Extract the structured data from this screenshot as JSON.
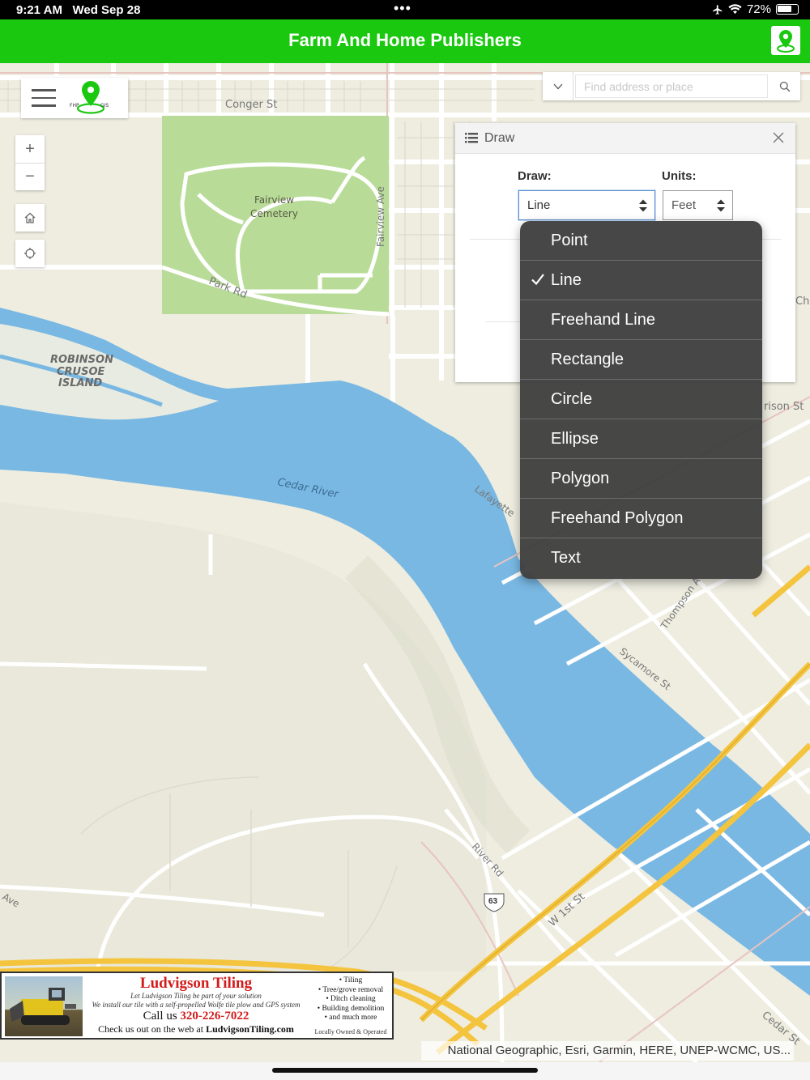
{
  "status_bar": {
    "time": "9:21 AM",
    "date": "Wed Sep 28",
    "battery": "72%",
    "battery_level": 0.72
  },
  "app_bar": {
    "title": "Farm And Home Publishers",
    "logo_icon": "map-pin-icon",
    "accent": "#19c80f"
  },
  "map": {
    "labels": {
      "conger_st": "Conger St",
      "cemetery_1": "Fairview",
      "cemetery_2": "Cemetery",
      "fairview_ave": "Fairview Ave",
      "park_rd": "Park Rd",
      "island_1": "ROBINSON",
      "island_2": "CRUSOE",
      "island_3": "ISLAND",
      "cedar_river": "Cedar River",
      "lafayette": "Lafayette",
      "harrison": "rison St",
      "ch": "Ch",
      "thompson": "Thompson A",
      "sycamore": "Sycamore St",
      "river_rd": "River Rd",
      "w1st": "W 1st St",
      "cedar_st": "Cedar St",
      "hwy": "63",
      "ave": "Ave"
    },
    "water_color": "#79b8e3",
    "park_color": "#b8dc98"
  },
  "menu": {
    "menu_icon": "hamburger-icon",
    "logo_icon": "fhp-gis-logo"
  },
  "controls": {
    "zoom_in": "+",
    "zoom_out": "−",
    "home_icon": "home-icon",
    "locate_icon": "locate-icon"
  },
  "search": {
    "placeholder": "Find address or place",
    "dropdown_icon": "caret-down-icon",
    "search_icon": "search-icon"
  },
  "draw_panel": {
    "title": "Draw",
    "draw_label": "Draw:",
    "draw_value": "Line",
    "units_label": "Units:",
    "units_value": "Feet"
  },
  "draw_options": [
    {
      "label": "Point",
      "selected": false
    },
    {
      "label": "Line",
      "selected": true
    },
    {
      "label": "Freehand Line",
      "selected": false
    },
    {
      "label": "Rectangle",
      "selected": false
    },
    {
      "label": "Circle",
      "selected": false
    },
    {
      "label": "Ellipse",
      "selected": false
    },
    {
      "label": "Polygon",
      "selected": false
    },
    {
      "label": "Freehand Polygon",
      "selected": false
    },
    {
      "label": "Text",
      "selected": false
    }
  ],
  "ad": {
    "brand": "Ludvigson Tiling",
    "tag_1": "Let Ludvigson Tiling be part of your solution",
    "tag_2": "We install our tile with a self-propelled Wolfe tile plow and GPS system",
    "call_prefix": "Call us",
    "phone": "320-226-7022",
    "web_prefix": "Check us out on the web at",
    "web": "LudvigsonTiling.com",
    "bullets": [
      "• Tiling",
      "• Tree/grove removal",
      "• Ditch cleaning",
      "• Building demolition",
      "• and much more"
    ],
    "owned": "Locally Owned & Operated"
  },
  "attribution": "National Geographic, Esri, Garmin, HERE, UNEP-WCMC, US..."
}
